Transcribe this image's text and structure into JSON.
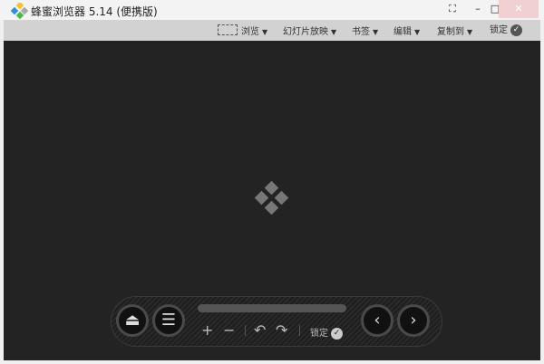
{
  "window": {
    "title": "蜂蜜浏览器 5.14 (便携版)"
  },
  "toolbar": {
    "items": [
      {
        "label": "浏览"
      },
      {
        "label": "幻灯片放映"
      },
      {
        "label": "书签"
      },
      {
        "label": "编辑"
      },
      {
        "label": "复制到"
      }
    ],
    "lock_label": "锁定"
  },
  "controls": {
    "lock_label": "锁定"
  }
}
